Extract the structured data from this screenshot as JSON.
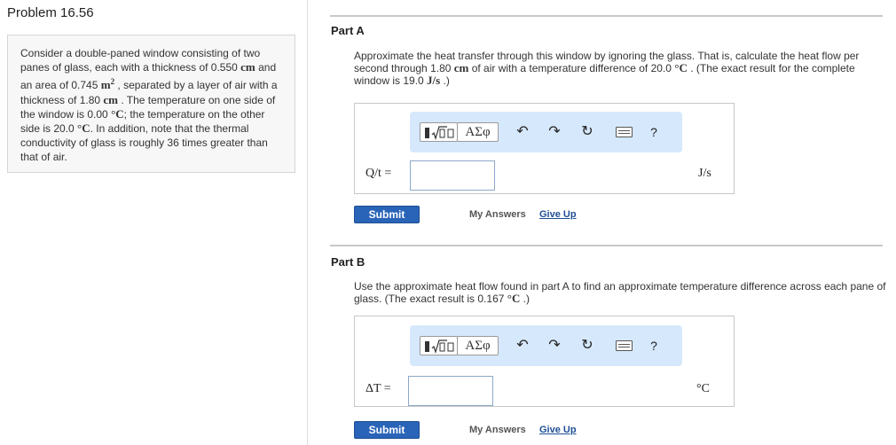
{
  "problem": {
    "title": "Problem 16.56",
    "text": {
      "s1": "Consider a double-paned window consisting of two panes of glass, each with a thickness of 0.550 ",
      "u1": "cm",
      "s2": " and an area of 0.745 ",
      "u2": "m",
      "u2sup": "2",
      "s3": " , separated by a layer of air with a thickness of 1.80 ",
      "u3": "cm",
      "s4": " . The temperature on one side of the window is 0.00 ",
      "u4": "°C",
      "s5": "; the temperature on the other side is 20.0 ",
      "u5": "°C",
      "s6": ". In addition, note that the thermal conductivity of glass is roughly 36 times greater than that of air."
    }
  },
  "toolbar": {
    "greek_label": "ΑΣφ",
    "undo_icon": "↶",
    "redo_icon": "↷",
    "reset_icon": "↻",
    "help_label": "?"
  },
  "part_a": {
    "title": "Part A",
    "q": {
      "s1": "Approximate the heat transfer through this window by ignoring the glass. That is, calculate the heat flow per second through 1.80 ",
      "u1": "cm",
      "s2": " of air with a temperature difference of 20.0 ",
      "u2": "°C",
      "s3": " . (The exact result for the complete window is 19.0 ",
      "u3": "J/s",
      "s4": " .)"
    },
    "answer_label": "Q/t =",
    "answer_value": "",
    "unit": "J/s",
    "submit_label": "Submit",
    "my_answers_label": "My Answers",
    "give_up_label": "Give Up"
  },
  "part_b": {
    "title": "Part B",
    "q": {
      "s1": "Use the approximate heat flow found in part A to find an approximate temperature difference across each pane of glass. (The exact result is 0.167 ",
      "u1": "°C",
      "s2": " .)"
    },
    "answer_label": "ΔT =",
    "answer_value": "",
    "unit": "°C",
    "submit_label": "Submit",
    "my_answers_label": "My Answers",
    "give_up_label": "Give Up"
  }
}
